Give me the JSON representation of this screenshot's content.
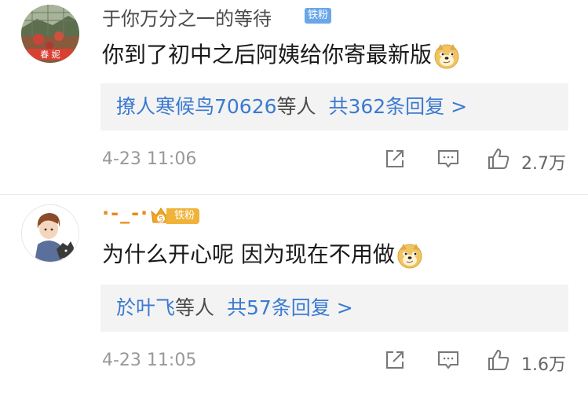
{
  "comments": [
    {
      "username": "于你万分之一的等待",
      "badge": "铁粉",
      "text": "你到了初中之后阿姨给你寄最新版",
      "emoji": "doge-emoji",
      "reply_users": "撩人寒候鸟70626",
      "reply_etc": "等人",
      "reply_total": "共362条回复 >",
      "time": "4-23 11:06",
      "likes": "2.7万",
      "avatar_caption": "春  妮"
    },
    {
      "username": "·-_-·",
      "badge": "铁粉",
      "text": "为什么开心呢 因为现在不用做",
      "emoji": "doge-emoji",
      "reply_users": "於叶飞",
      "reply_etc": "等人",
      "reply_total": "共57条回复 >",
      "time": "4-23 11:05",
      "likes": "1.6万"
    }
  ]
}
